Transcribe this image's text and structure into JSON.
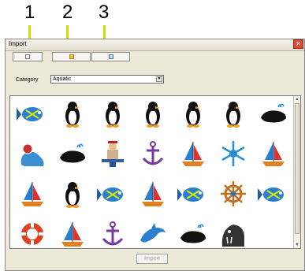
{
  "callouts": [
    "1",
    "2",
    "3"
  ],
  "window": {
    "title": "Import",
    "close_glyph": "×"
  },
  "tabs": [
    {
      "name": "tab-source-1",
      "icon": "square-icon"
    },
    {
      "name": "tab-source-2",
      "icon": "folder-icon"
    },
    {
      "name": "tab-source-3",
      "icon": "document-icon"
    }
  ],
  "category": {
    "label": "Category",
    "value": "Aquatic"
  },
  "designs": [
    "fish",
    "penguin",
    "penguin",
    "penguin",
    "penguin",
    "penguin",
    "whale",
    "seal",
    "whale",
    "sailor",
    "anchor",
    "sailboat",
    "snowflake",
    "sailboat",
    "sailboat",
    "penguin",
    "fish",
    "sailboat",
    "fish",
    "ship-wheel",
    "fish",
    "life-ring",
    "sailboat",
    "anchor",
    "dolphin",
    "whale",
    "walrus"
  ],
  "scrollbar": {
    "up": "▴",
    "down": "▾"
  },
  "import_button": {
    "label": "Import",
    "enabled": false
  },
  "colors": {
    "callout_line": "#c8e000",
    "window_bg": "#ece9d8"
  }
}
